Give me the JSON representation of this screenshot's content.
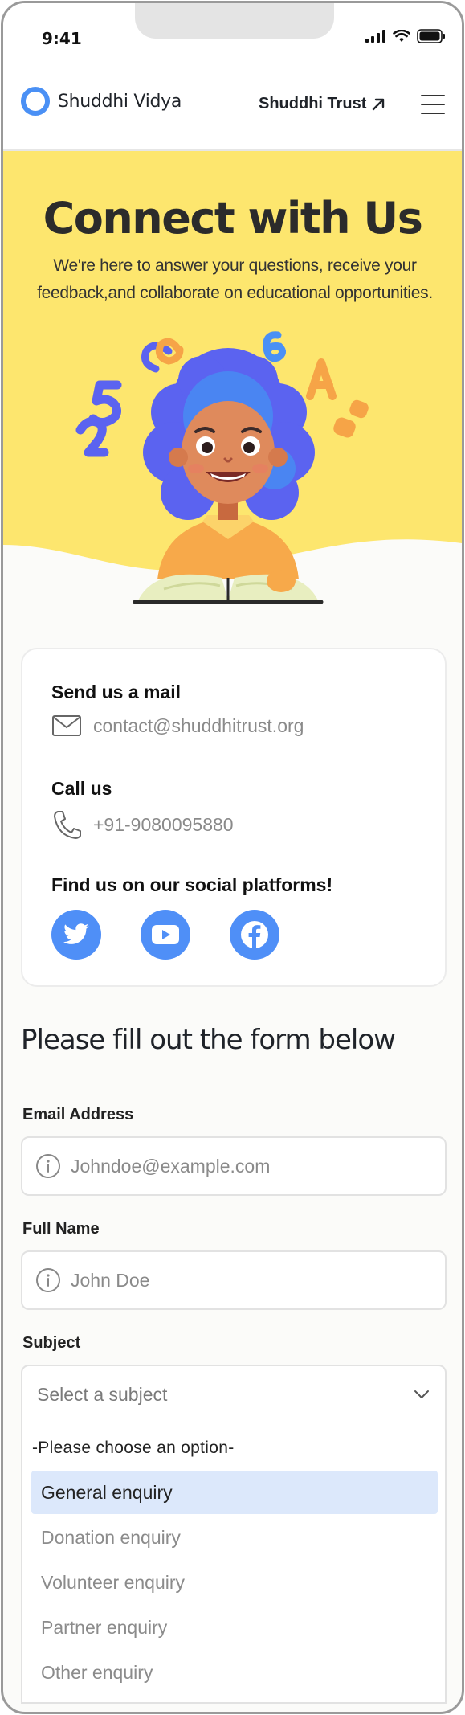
{
  "status_bar": {
    "time": "9:41"
  },
  "header": {
    "logo_text": "Shuddhi Vidya",
    "trust_link": "Shuddhi Trust",
    "colors": {
      "accent": "#4a90f5"
    }
  },
  "hero": {
    "title": "Connect with Us",
    "subtitle": "We're here to answer your questions, receive your feedback,and collaborate on educational opportunities.",
    "background": "#fde66e"
  },
  "contact": {
    "mail_heading": "Send us a mail",
    "email": "contact@shuddhitrust.org",
    "call_heading": "Call us",
    "phone": "+91-9080095880",
    "social_heading": "Find us on our social platforms!",
    "social": [
      {
        "icon": "twitter-icon"
      },
      {
        "icon": "youtube-icon"
      },
      {
        "icon": "facebook-icon"
      }
    ]
  },
  "form": {
    "title": "Please fill out the form below",
    "email_label": "Email Address",
    "email_placeholder": "Johndoe@example.com",
    "name_label": "Full Name",
    "name_placeholder": "John Doe",
    "subject_label": "Subject",
    "subject_placeholder": "Select a subject",
    "options_header": "-Please choose an option-",
    "options": [
      {
        "label": "General enquiry",
        "selected": true
      },
      {
        "label": "Donation enquiry",
        "selected": false
      },
      {
        "label": "Volunteer enquiry",
        "selected": false
      },
      {
        "label": "Partner enquiry",
        "selected": false
      },
      {
        "label": "Other enquiry",
        "selected": false
      }
    ]
  }
}
